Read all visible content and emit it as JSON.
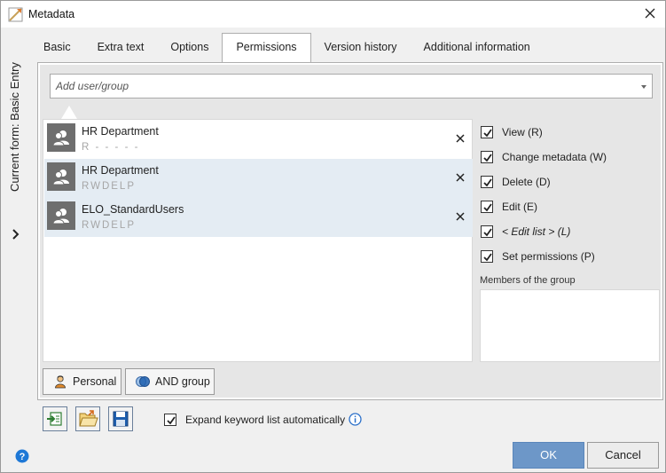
{
  "window": {
    "title": "Metadata",
    "sidebar_label": "Current form: Basic Entry"
  },
  "tabs": [
    {
      "label": "Basic"
    },
    {
      "label": "Extra text"
    },
    {
      "label": "Options"
    },
    {
      "label": "Permissions",
      "active": true
    },
    {
      "label": "Version history"
    },
    {
      "label": "Additional information"
    }
  ],
  "search": {
    "placeholder": "Add user/group"
  },
  "entries": [
    {
      "name": "HR Department",
      "permissions": "R - - - - -",
      "selected": false
    },
    {
      "name": "HR Department",
      "permissions": "RWDELP",
      "selected": true
    },
    {
      "name": "ELO_StandardUsers",
      "permissions": "RWDELP",
      "selected": true
    }
  ],
  "permission_checks": [
    {
      "label": "View (R)",
      "checked": true
    },
    {
      "label": "Change metadata (W)",
      "checked": true
    },
    {
      "label": "Delete (D)",
      "checked": true
    },
    {
      "label": "Edit (E)",
      "checked": true
    },
    {
      "label": "< Edit list > (L)",
      "checked": true,
      "italic": true
    },
    {
      "label": "Set permissions (P)",
      "checked": true
    }
  ],
  "members": {
    "label": "Members of the group"
  },
  "buttons": {
    "personal": "Personal",
    "and_group": "AND group",
    "ok": "OK",
    "cancel": "Cancel"
  },
  "options": {
    "expand_keyword_label": "Expand keyword list automatically",
    "expand_keyword_checked": true
  },
  "icons": {
    "app": "metadata-form-icon",
    "user_group": "user-group-icon",
    "remove": "close-icon",
    "personal": "person-icon",
    "and_group": "and-group-icon",
    "toolbar": [
      "import-icon",
      "open-folder-icon",
      "save-icon"
    ],
    "help": "help-icon",
    "info": "info-icon"
  },
  "colors": {
    "accent": "#6d97c8",
    "selection": "#e4ecf3",
    "avatar": "#6e6e6e",
    "help_blue": "#1e78d6"
  }
}
